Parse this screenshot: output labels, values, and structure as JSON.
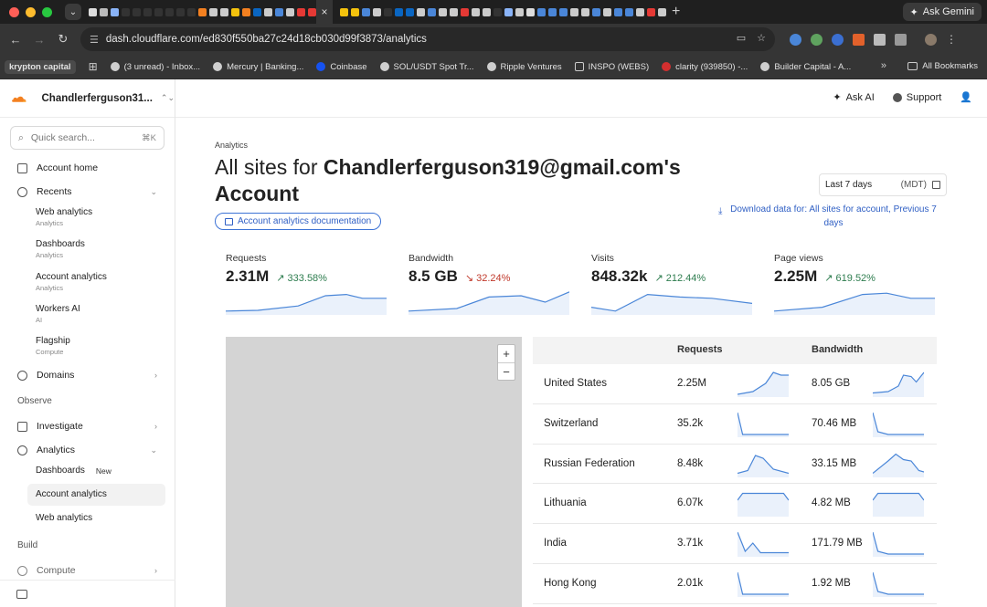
{
  "browser": {
    "active_tab_close": "×",
    "new_tab": "+",
    "gemini_label": "Ask Gemini",
    "url": "dash.cloudflare.com/ed830f550ba27c24d18cb030d99f3873/analytics",
    "bookmarks": [
      {
        "label": "krypton capital",
        "icon": "folder-icon"
      },
      {
        "label": "(3 unread) - Inbox...",
        "icon": "mail-icon"
      },
      {
        "label": "Mercury | Banking...",
        "icon": "globe-icon"
      },
      {
        "label": "Coinbase",
        "icon": "coinbase-icon"
      },
      {
        "label": "SOL/USDT Spot Tr...",
        "icon": "globe-icon"
      },
      {
        "label": "Ripple Ventures",
        "icon": "globe-icon"
      },
      {
        "label": "INSPO (WEBS)",
        "icon": "folder-icon"
      },
      {
        "label": "clarity (939850) -...",
        "icon": "clarity-icon"
      },
      {
        "label": "Builder Capital - A...",
        "icon": "globe-icon"
      }
    ],
    "bookmarks_overflow": "»",
    "all_bookmarks": "All Bookmarks"
  },
  "sidebar": {
    "account": "Chandlerferguson31...",
    "search_placeholder": "Quick search...",
    "search_shortcut": "⌘K",
    "account_home": "Account home",
    "recents": "Recents",
    "recent_items": [
      {
        "label": "Web analytics",
        "caption": "Analytics"
      },
      {
        "label": "Dashboards",
        "caption": "Analytics"
      },
      {
        "label": "Account analytics",
        "caption": "Analytics"
      },
      {
        "label": "Workers AI",
        "caption": "AI"
      },
      {
        "label": "Flagship",
        "caption": "Compute"
      }
    ],
    "domains": "Domains",
    "observe": "Observe",
    "investigate": "Investigate",
    "analytics": "Analytics",
    "analytics_children": [
      {
        "label": "Dashboards",
        "badge": "New"
      },
      {
        "label": "Account analytics",
        "badge": ""
      },
      {
        "label": "Web analytics",
        "badge": ""
      }
    ],
    "build": "Build",
    "compute": "Compute"
  },
  "topbar": {
    "ask_ai": "Ask AI",
    "support": "Support"
  },
  "main": {
    "breadcrumb": "Analytics",
    "title_prefix": "All sites for ",
    "title_account": "Chandlerferguson319@gmail.com's Account",
    "doc_link": "Account analytics documentation",
    "date_range": "Last 7 days",
    "timezone": "(MDT)",
    "download_text": "Download data for: All sites for account, Previous 7 days",
    "kpis": [
      {
        "label": "Requests",
        "value": "2.31M",
        "change": "333.58%",
        "direction": "up"
      },
      {
        "label": "Bandwidth",
        "value": "8.5 GB",
        "change": "32.24%",
        "direction": "down"
      },
      {
        "label": "Visits",
        "value": "848.32k",
        "change": "212.44%",
        "direction": "up"
      },
      {
        "label": "Page views",
        "value": "2.25M",
        "change": "619.52%",
        "direction": "up"
      }
    ],
    "map_zoom_in": "+",
    "map_zoom_out": "−",
    "table_headers": {
      "requests": "Requests",
      "bandwidth": "Bandwidth"
    },
    "countries": [
      {
        "country": "United States",
        "requests": "2.25M",
        "bandwidth": "8.05 GB"
      },
      {
        "country": "Switzerland",
        "requests": "35.2k",
        "bandwidth": "70.46 MB"
      },
      {
        "country": "Russian Federation",
        "requests": "8.48k",
        "bandwidth": "33.15 MB"
      },
      {
        "country": "Lithuania",
        "requests": "6.07k",
        "bandwidth": "4.82 MB"
      },
      {
        "country": "India",
        "requests": "3.71k",
        "bandwidth": "171.79 MB"
      },
      {
        "country": "Hong Kong",
        "requests": "2.01k",
        "bandwidth": "1.92 MB"
      }
    ]
  },
  "colors": {
    "accent": "#2f5fc4",
    "positive": "#2e7d4f",
    "negative": "#c0392b",
    "cloudflare_orange": "#f38020",
    "sparkline": "#4a86d8"
  }
}
